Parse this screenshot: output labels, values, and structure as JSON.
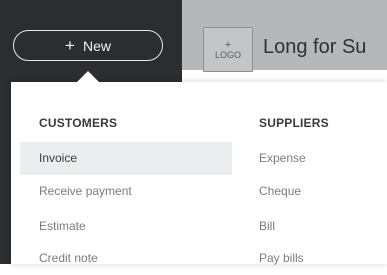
{
  "new_button": {
    "icon": "plus-icon",
    "plus": "+",
    "label": "New"
  },
  "header": {
    "logo": {
      "plus": "+",
      "label": "LOGO"
    },
    "company_name": "Long for Su"
  },
  "menu": {
    "customers": {
      "heading": "CUSTOMERS",
      "items": [
        "Invoice",
        "Receive payment",
        "Estimate",
        "Credit note"
      ],
      "active_index": 0
    },
    "suppliers": {
      "heading": "SUPPLIERS",
      "items": [
        "Expense",
        "Cheque",
        "Bill",
        "Pay bills"
      ]
    }
  },
  "colors": {
    "sidebar": "#2b2d30",
    "header": "#b5b7b8",
    "active_row": "#ecedee"
  }
}
